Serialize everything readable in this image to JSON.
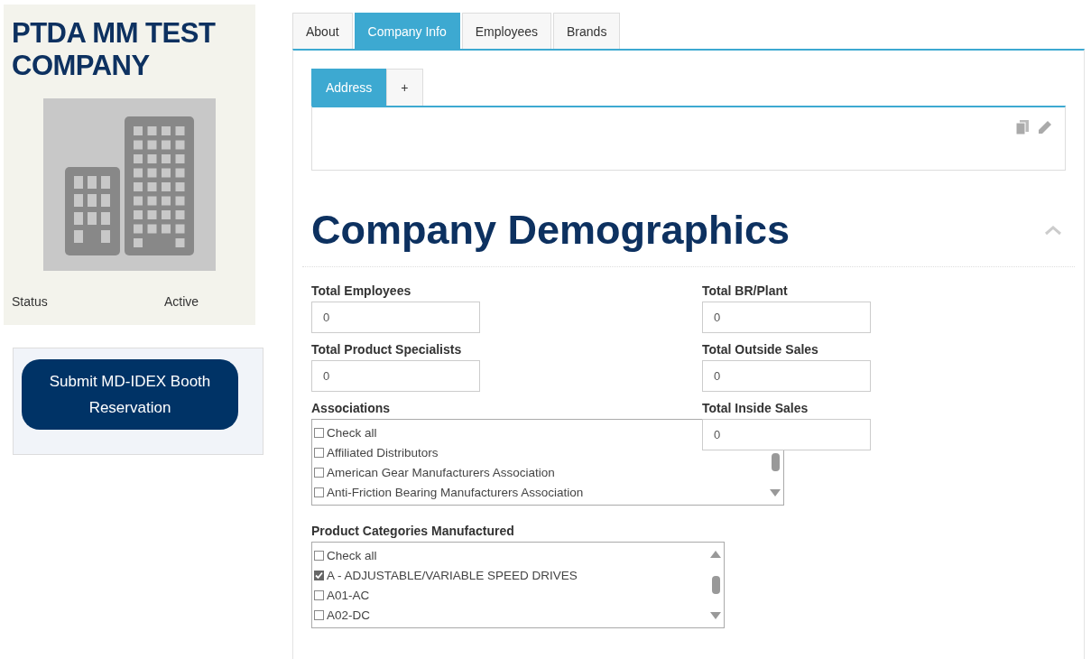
{
  "sidebar": {
    "title": "PTDA MM TEST COMPANY",
    "status_label": "Status",
    "status_value": "Active",
    "submit_button": "Submit MD-IDEX Booth Reservation"
  },
  "tabs": [
    {
      "label": "About",
      "selected": false
    },
    {
      "label": "Company Info",
      "selected": true
    },
    {
      "label": "Employees",
      "selected": false
    },
    {
      "label": "Brands",
      "selected": false
    }
  ],
  "address_tabs": [
    {
      "label": "Address",
      "selected": true
    },
    {
      "label": "+",
      "selected": false
    }
  ],
  "section": {
    "title": "Company Demographics",
    "expanded": true
  },
  "fields": [
    {
      "kind": "input",
      "label": "Total Employees",
      "value": "0"
    },
    {
      "kind": "input",
      "label": "Total BR/Plant",
      "value": "0"
    },
    {
      "kind": "input",
      "label": "Total Product Specialists",
      "value": "0"
    },
    {
      "kind": "input",
      "label": "Total Outside Sales",
      "value": "0"
    },
    {
      "kind": "checklist",
      "label": "Associations",
      "items": [
        {
          "label": "Check all",
          "checked": false
        },
        {
          "label": "Affiliated Distributors",
          "checked": false
        },
        {
          "label": "American Gear Manufacturers Association",
          "checked": false
        },
        {
          "label": "Anti-Friction Bearing Manufacturers Association",
          "checked": false
        }
      ]
    },
    {
      "kind": "input",
      "label": "Total Inside Sales",
      "value": "0"
    },
    {
      "kind": "checklist",
      "label": "Product Categories Manufactured",
      "items": [
        {
          "label": "Check all",
          "checked": false
        },
        {
          "label": "A - ADJUSTABLE/VARIABLE SPEED DRIVES",
          "checked": true
        },
        {
          "label": "A01-AC",
          "checked": false
        },
        {
          "label": "A02-DC",
          "checked": false
        }
      ]
    }
  ]
}
